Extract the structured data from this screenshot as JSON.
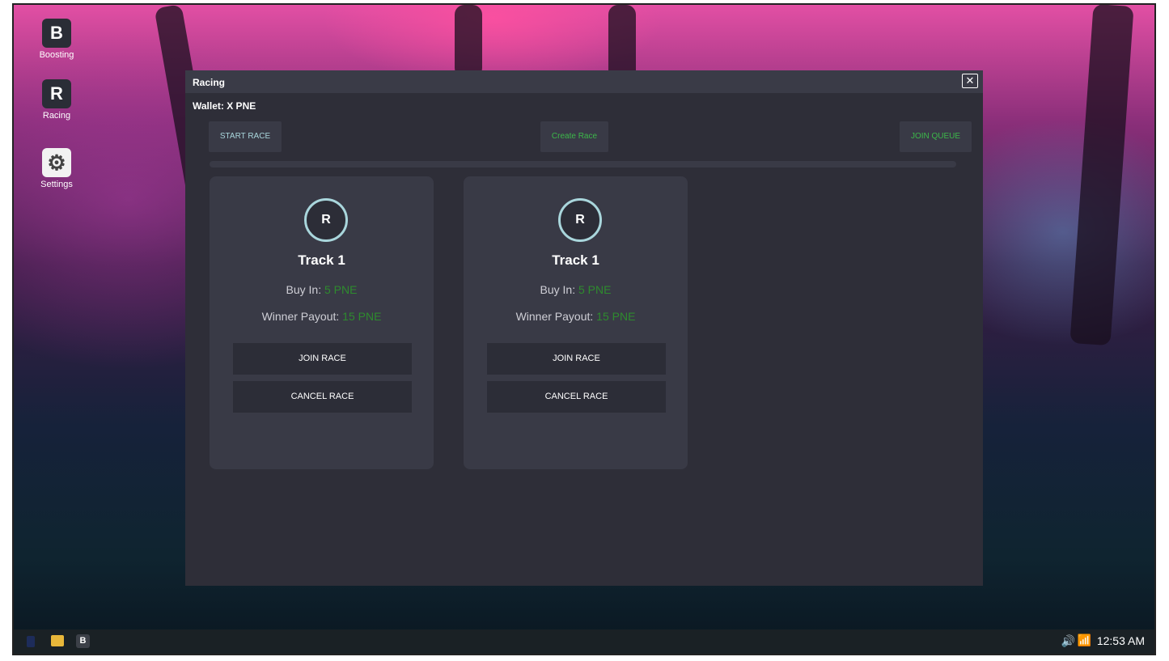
{
  "desktop": {
    "icons": [
      {
        "letter": "B",
        "label": "Boosting"
      },
      {
        "letter": "R",
        "label": "Racing"
      },
      {
        "letter": "⚙",
        "label": "Settings"
      }
    ]
  },
  "window": {
    "title": "Racing",
    "close_glyph": "✕",
    "wallet": "Wallet: X PNE",
    "buttons": {
      "start_race": "START RACE",
      "create_race": "Create Race",
      "join_queue": "JOIN QUEUE"
    },
    "cards": [
      {
        "avatar": "R",
        "track": "Track 1",
        "buy_in_label": "Buy In:",
        "buy_in_value": "5 PNE",
        "payout_label": "Winner Payout:",
        "payout_value": "15 PNE",
        "join": "JOIN RACE",
        "cancel": "CANCEL RACE"
      },
      {
        "avatar": "R",
        "track": "Track 1",
        "buy_in_label": "Buy In:",
        "buy_in_value": "5 PNE",
        "payout_label": "Winner Payout:",
        "payout_value": "15 PNE",
        "join": "JOIN RACE",
        "cancel": "CANCEL RACE"
      }
    ]
  },
  "taskbar": {
    "app_letter": "B",
    "clock": "12:53 AM"
  },
  "colors": {
    "window_bg": "#2e2e38",
    "card_bg": "#393a46",
    "accent_teal": "#a9d6dc",
    "payout_green": "#2e8b2e",
    "create_green": "#3cb84a"
  }
}
